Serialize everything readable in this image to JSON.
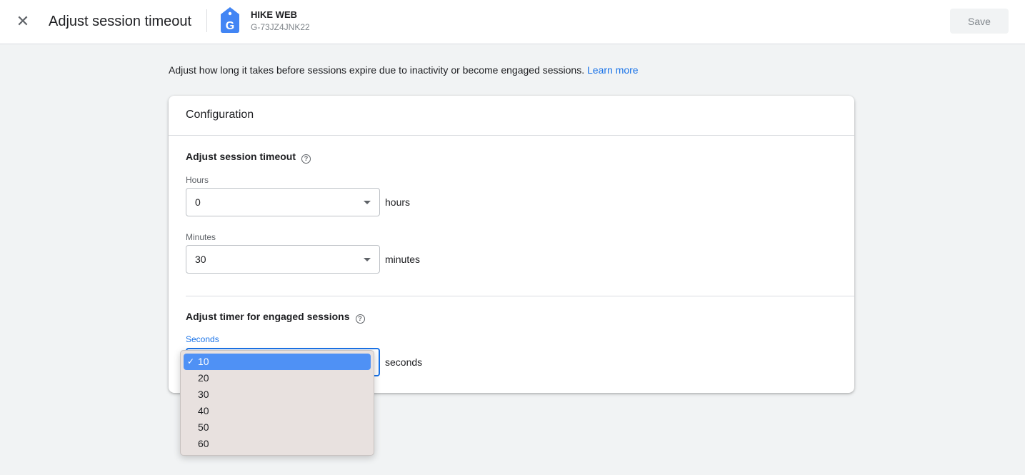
{
  "header": {
    "title": "Adjust session timeout",
    "property_name": "HIKE WEB",
    "property_id": "G-73JZ4JNK22",
    "save_label": "Save",
    "close_icon": "close-icon",
    "brand_color": "#4285f4"
  },
  "intro": {
    "text": "Adjust how long it takes before sessions expire due to inactivity or become engaged sessions. ",
    "link": "Learn more"
  },
  "card": {
    "title": "Configuration",
    "session": {
      "title": "Adjust session timeout",
      "hours_label": "Hours",
      "hours_value": "0",
      "hours_unit": "hours",
      "minutes_label": "Minutes",
      "minutes_value": "30",
      "minutes_unit": "minutes"
    },
    "engaged": {
      "title": "Adjust timer for engaged sessions",
      "seconds_label": "Seconds",
      "seconds_value": "10",
      "seconds_unit": "seconds"
    }
  },
  "dropdown": {
    "selected": "10",
    "options": [
      "10",
      "20",
      "30",
      "40",
      "50",
      "60"
    ]
  }
}
